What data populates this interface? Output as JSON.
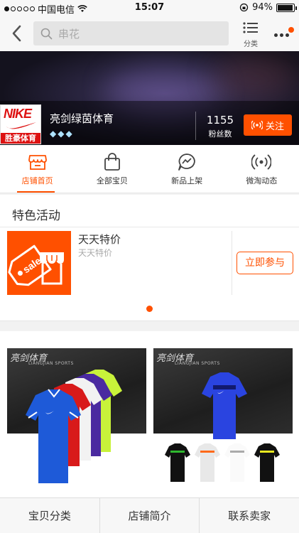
{
  "status_bar": {
    "carrier": "中国电信",
    "time": "15:07",
    "battery": "94%",
    "battery_level": 0.94
  },
  "nav": {
    "search_placeholder": "串花",
    "category_label": "分类"
  },
  "shop": {
    "logo_brand": "NIKE",
    "logo_name": "胜豪体育",
    "name": "亮剑绿茵体育",
    "diamonds": [
      "◆",
      "◆",
      "◆"
    ],
    "fans_count": "1155",
    "fans_label": "粉丝数",
    "follow_label": "关注"
  },
  "tabs": [
    {
      "label": "店铺首页",
      "icon": "storefront-icon",
      "active": true
    },
    {
      "label": "全部宝贝",
      "icon": "bag-icon",
      "active": false
    },
    {
      "label": "新品上架",
      "icon": "lightning-chat-icon",
      "active": false
    },
    {
      "label": "微淘动态",
      "icon": "broadcast-icon",
      "active": false
    }
  ],
  "activity": {
    "section_title": "特色活动",
    "name": "天天特价",
    "subtitle": "天天特价",
    "join_label": "立即参与",
    "icon_text": "sale"
  },
  "products": [
    {
      "brand": "亮剑体育",
      "brand_en": "LIANGJIAN SPORTS"
    },
    {
      "brand": "亮剑体育",
      "brand_en": "LIANGJIAN SPORTS"
    }
  ],
  "bottom_bar": {
    "items": [
      "宝贝分类",
      "店铺简介",
      "联系卖家"
    ]
  },
  "colors": {
    "accent": "#ff5000"
  }
}
